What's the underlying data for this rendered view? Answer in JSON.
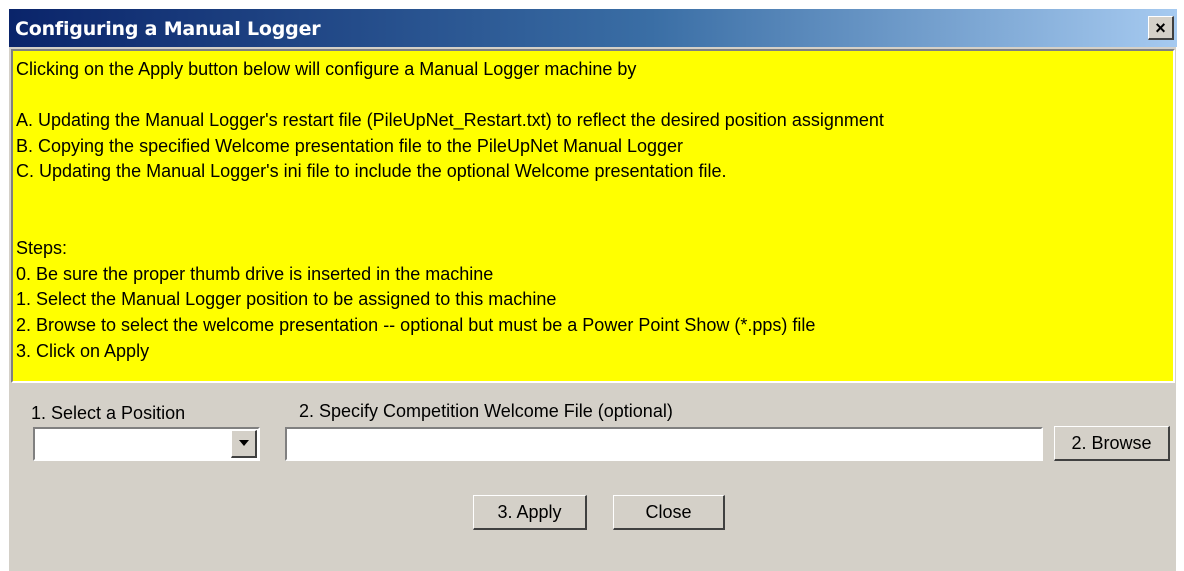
{
  "window": {
    "title": "Configuring a Manual Logger",
    "close_glyph": "×",
    "titlebar_colors": [
      "#0a246a",
      "#a6caf0"
    ]
  },
  "info": {
    "background": "#ffff00",
    "lines": [
      "Clicking on the Apply button below will configure a Manual Logger machine by",
      "",
      "A. Updating the Manual Logger's restart file (PileUpNet_Restart.txt) to reflect the desired position assignment",
      "B. Copying the specified Welcome presentation file to the PileUpNet Manual Logger",
      "C. Updating the Manual Logger's ini file to include the optional Welcome presentation file.",
      "",
      "",
      "Steps:",
      "0. Be sure the proper thumb drive is inserted in the machine",
      "1. Select the Manual Logger position to be assigned to this machine",
      "2. Browse to select the welcome presentation -- optional but must be a Power Point Show (*.pps) file",
      "3. Click on Apply"
    ]
  },
  "position": {
    "label": "1. Select a Position",
    "value": ""
  },
  "welcome_file": {
    "label": "2. Specify Competition Welcome File (optional)",
    "value": "",
    "placeholder": ""
  },
  "buttons": {
    "browse": "2. Browse",
    "apply": "3. Apply",
    "close": "Close"
  }
}
